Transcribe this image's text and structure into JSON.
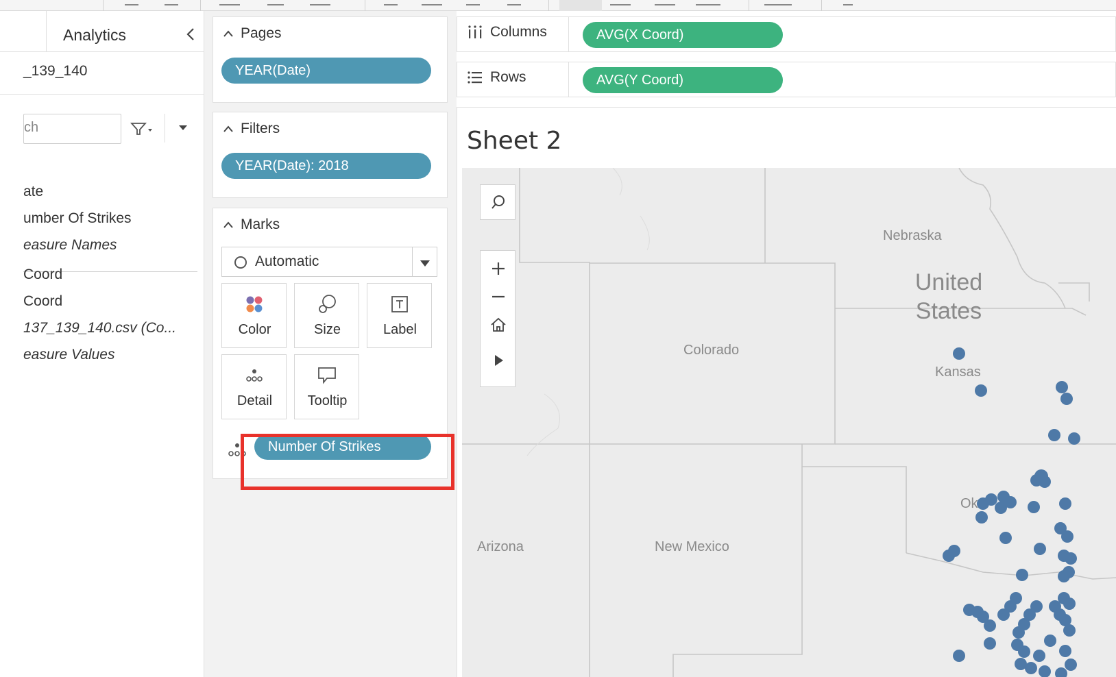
{
  "data_pane": {
    "analytics_tab": "Analytics",
    "datasource_name": "_139_140",
    "search_placeholder": "ch",
    "fields": [
      {
        "label": "ate",
        "italic": false
      },
      {
        "label": "umber Of Strikes",
        "italic": false
      },
      {
        "label": "easure Names",
        "italic": true
      },
      {
        "label": "Coord",
        "italic": false
      },
      {
        "label": "Coord",
        "italic": false
      },
      {
        "label": "137_139_140.csv (Co...",
        "italic": true
      },
      {
        "label": "easure Values",
        "italic": true
      }
    ]
  },
  "shelves": {
    "pages": {
      "title": "Pages",
      "pill": "YEAR(Date)"
    },
    "filters": {
      "title": "Filters",
      "pill": "YEAR(Date): 2018"
    },
    "marks": {
      "title": "Marks",
      "type": "Automatic",
      "buttons": [
        "Color",
        "Size",
        "Label",
        "Detail",
        "Tooltip"
      ],
      "detail_pill": "Number Of Strikes"
    },
    "columns": {
      "label": "Columns",
      "pill": "AVG(X Coord)"
    },
    "rows": {
      "label": "Rows",
      "pill": "AVG(Y Coord)"
    }
  },
  "viz": {
    "title": "Sheet 2",
    "map_labels": {
      "nebraska": "Nebraska",
      "united": "United",
      "states": "States",
      "colorado": "Colorado",
      "kansas": "Kansas",
      "arizona": "Arizona",
      "new_mexico": "New Mexico",
      "oklahoma_partial": "Ok"
    },
    "point_color": "#4e79a7"
  },
  "colors": {
    "blue_pill": "#4f98b3",
    "green_pill": "#3db37f",
    "highlight": "#e8322b"
  }
}
